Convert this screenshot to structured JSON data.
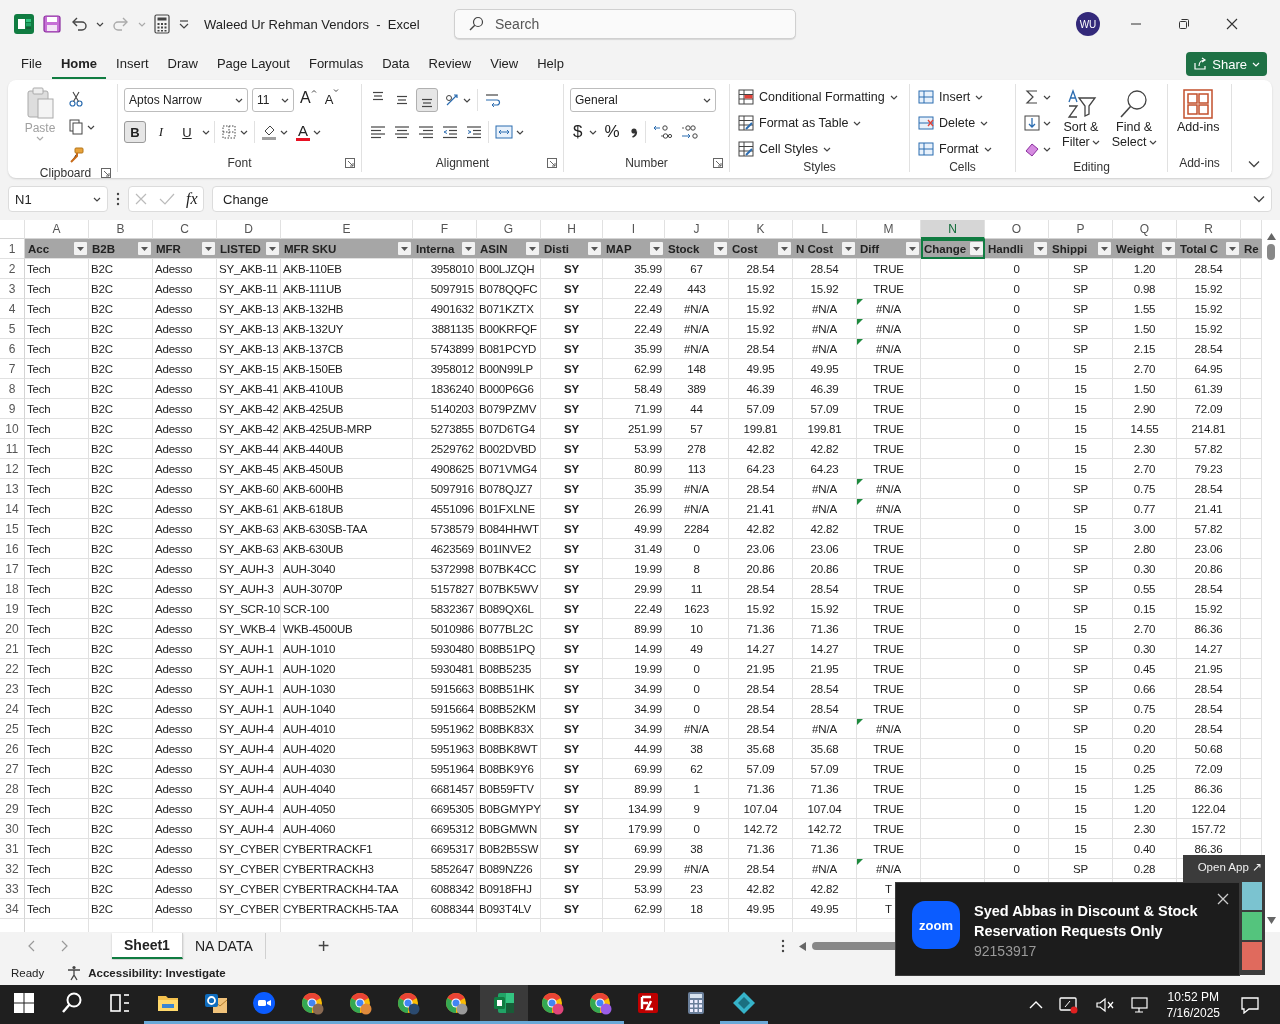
{
  "window": {
    "title": "Waleed Ur Rehman Vendors  -  Excel",
    "search": {
      "placeholder": "Search"
    },
    "avatar": "WU"
  },
  "menu": [
    {
      "label": "File",
      "selected": false
    },
    {
      "label": "Home",
      "selected": true
    },
    {
      "label": "Insert",
      "selected": false
    },
    {
      "label": "Draw",
      "selected": false
    },
    {
      "label": "Page Layout",
      "selected": false
    },
    {
      "label": "Formulas",
      "selected": false
    },
    {
      "label": "Data",
      "selected": false
    },
    {
      "label": "Review",
      "selected": false
    },
    {
      "label": "View",
      "selected": false
    },
    {
      "label": "Help",
      "selected": false
    }
  ],
  "share": "Share",
  "ribbon": {
    "groups": [
      {
        "kind": "clipboard",
        "label": "Clipboard",
        "paste": {
          "label": "Paste",
          "disabled": true
        }
      },
      {
        "kind": "font",
        "label": "Font",
        "font_name": "Aptos Narrow",
        "font_size": "11",
        "grow": "A",
        "shrink": "A",
        "font_color": "A",
        "styles": [
          {
            "label": "B",
            "selected": true
          },
          {
            "label": "I",
            "selected": false
          },
          {
            "label": "U",
            "selected": false
          }
        ]
      },
      {
        "kind": "alignment",
        "label": "Alignment",
        "vertical": [
          {
            "selected": false
          },
          {
            "selected": false
          },
          {
            "selected": true
          }
        ]
      },
      {
        "kind": "number",
        "label": "Number",
        "format": "General",
        "currency": "$",
        "percent": "%"
      },
      {
        "kind": "styles",
        "label": "Styles",
        "items": [
          "Conditional Formatting",
          "Format as Table",
          "Cell Styles"
        ]
      },
      {
        "kind": "cells",
        "label": "Cells",
        "items": [
          "Insert",
          "Delete",
          "Format"
        ]
      },
      {
        "kind": "editing",
        "label": "Editing",
        "items": [
          [
            "Sort &",
            "Filter"
          ],
          [
            "Find &",
            "Select"
          ]
        ]
      },
      {
        "kind": "addins",
        "label": "Add-ins",
        "items": [
          "Add-ins"
        ]
      }
    ]
  },
  "formula_bar": {
    "name_box": "N1",
    "function_button": "fx",
    "value": "Change"
  },
  "columns": [
    {
      "letter": "A",
      "header": "Acc",
      "selected": false
    },
    {
      "letter": "B",
      "header": "B2B",
      "selected": false
    },
    {
      "letter": "C",
      "header": "MFR",
      "selected": false
    },
    {
      "letter": "D",
      "header": "LISTED",
      "selected": false
    },
    {
      "letter": "E",
      "header": "MFR SKU",
      "selected": false
    },
    {
      "letter": "F",
      "header": "Interna",
      "selected": false
    },
    {
      "letter": "G",
      "header": "ASIN",
      "selected": false
    },
    {
      "letter": "H",
      "header": "Disti",
      "selected": false
    },
    {
      "letter": "I",
      "header": "MAP",
      "selected": false
    },
    {
      "letter": "J",
      "header": "Stock",
      "selected": false
    },
    {
      "letter": "K",
      "header": "Cost",
      "selected": false
    },
    {
      "letter": "L",
      "header": "N Cost",
      "selected": false
    },
    {
      "letter": "M",
      "header": "Diff",
      "selected": false
    },
    {
      "letter": "N",
      "header": "Change",
      "selected": true
    },
    {
      "letter": "O",
      "header": "Handli",
      "selected": false
    },
    {
      "letter": "P",
      "header": "Shippi",
      "selected": false
    },
    {
      "letter": "Q",
      "header": "Weight",
      "selected": false
    },
    {
      "letter": "R",
      "header": "Total C",
      "selected": false
    }
  ],
  "partial_column": {
    "header": "Re"
  },
  "header_row": "1",
  "rows": [
    {
      "row": "2",
      "error_flag": false,
      "cells": [
        "Tech",
        "B2C",
        "Adesso",
        "SY_AKB-11",
        "AKB-110EB",
        "3958010",
        "B00LJZQH",
        "SY",
        "35.99",
        "67",
        "28.54",
        "28.54",
        "TRUE",
        null,
        "0",
        "SP",
        "1.20",
        "28.54"
      ]
    },
    {
      "row": "3",
      "error_flag": false,
      "cells": [
        "Tech",
        "B2C",
        "Adesso",
        "SY_AKB-11",
        "AKB-111UB",
        "5097915",
        "B078QQFC",
        "SY",
        "22.49",
        "443",
        "15.92",
        "15.92",
        "TRUE",
        null,
        "0",
        "SP",
        "0.98",
        "15.92"
      ]
    },
    {
      "row": "4",
      "error_flag": true,
      "cells": [
        "Tech",
        "B2C",
        "Adesso",
        "SY_AKB-13",
        "AKB-132HB",
        "4901632",
        "B071KZTX",
        "SY",
        "22.49",
        "#N/A",
        "15.92",
        "#N/A",
        "#N/A",
        null,
        "0",
        "SP",
        "1.55",
        "15.92"
      ]
    },
    {
      "row": "5",
      "error_flag": true,
      "cells": [
        "Tech",
        "B2C",
        "Adesso",
        "SY_AKB-13",
        "AKB-132UY",
        "3881135",
        "B00KRFQF",
        "SY",
        "22.49",
        "#N/A",
        "15.92",
        "#N/A",
        "#N/A",
        null,
        "0",
        "SP",
        "1.50",
        "15.92"
      ]
    },
    {
      "row": "6",
      "error_flag": true,
      "cells": [
        "Tech",
        "B2C",
        "Adesso",
        "SY_AKB-13",
        "AKB-137CB",
        "5743899",
        "B081PCYD",
        "SY",
        "35.99",
        "#N/A",
        "28.54",
        "#N/A",
        "#N/A",
        null,
        "0",
        "SP",
        "2.15",
        "28.54"
      ]
    },
    {
      "row": "7",
      "error_flag": false,
      "cells": [
        "Tech",
        "B2C",
        "Adesso",
        "SY_AKB-15",
        "AKB-150EB",
        "3958012",
        "B00N99LP",
        "SY",
        "62.99",
        "148",
        "49.95",
        "49.95",
        "TRUE",
        null,
        "0",
        "15",
        "2.70",
        "64.95"
      ]
    },
    {
      "row": "8",
      "error_flag": false,
      "cells": [
        "Tech",
        "B2C",
        "Adesso",
        "SY_AKB-41",
        "AKB-410UB",
        "1836240",
        "B000P6G6",
        "SY",
        "58.49",
        "389",
        "46.39",
        "46.39",
        "TRUE",
        null,
        "0",
        "15",
        "1.50",
        "61.39"
      ]
    },
    {
      "row": "9",
      "error_flag": false,
      "cells": [
        "Tech",
        "B2C",
        "Adesso",
        "SY_AKB-42",
        "AKB-425UB",
        "5140203",
        "B079PZMV",
        "SY",
        "71.99",
        "44",
        "57.09",
        "57.09",
        "TRUE",
        null,
        "0",
        "15",
        "2.90",
        "72.09"
      ]
    },
    {
      "row": "10",
      "error_flag": false,
      "cells": [
        "Tech",
        "B2C",
        "Adesso",
        "SY_AKB-42",
        "AKB-425UB-MRP",
        "5273855",
        "B07D6TG4",
        "SY",
        "251.99",
        "57",
        "199.81",
        "199.81",
        "TRUE",
        null,
        "0",
        "15",
        "14.55",
        "214.81"
      ]
    },
    {
      "row": "11",
      "error_flag": false,
      "cells": [
        "Tech",
        "B2C",
        "Adesso",
        "SY_AKB-44",
        "AKB-440UB",
        "2529762",
        "B002DVBD",
        "SY",
        "53.99",
        "278",
        "42.82",
        "42.82",
        "TRUE",
        null,
        "0",
        "15",
        "2.30",
        "57.82"
      ]
    },
    {
      "row": "12",
      "error_flag": false,
      "cells": [
        "Tech",
        "B2C",
        "Adesso",
        "SY_AKB-45",
        "AKB-450UB",
        "4908625",
        "B071VMG4",
        "SY",
        "80.99",
        "113",
        "64.23",
        "64.23",
        "TRUE",
        null,
        "0",
        "15",
        "2.70",
        "79.23"
      ]
    },
    {
      "row": "13",
      "error_flag": true,
      "cells": [
        "Tech",
        "B2C",
        "Adesso",
        "SY_AKB-60",
        "AKB-600HB",
        "5097916",
        "B078QJZ7",
        "SY",
        "35.99",
        "#N/A",
        "28.54",
        "#N/A",
        "#N/A",
        null,
        "0",
        "SP",
        "0.75",
        "28.54"
      ]
    },
    {
      "row": "14",
      "error_flag": true,
      "cells": [
        "Tech",
        "B2C",
        "Adesso",
        "SY_AKB-61",
        "AKB-618UB",
        "4551096",
        "B01FXLNE",
        "SY",
        "26.99",
        "#N/A",
        "21.41",
        "#N/A",
        "#N/A",
        null,
        "0",
        "SP",
        "0.77",
        "21.41"
      ]
    },
    {
      "row": "15",
      "error_flag": false,
      "cells": [
        "Tech",
        "B2C",
        "Adesso",
        "SY_AKB-63",
        "AKB-630SB-TAA",
        "5738579",
        "B084HHWT",
        "SY",
        "49.99",
        "2284",
        "42.82",
        "42.82",
        "TRUE",
        null,
        "0",
        "15",
        "3.00",
        "57.82"
      ]
    },
    {
      "row": "16",
      "error_flag": false,
      "cells": [
        "Tech",
        "B2C",
        "Adesso",
        "SY_AKB-63",
        "AKB-630UB",
        "4623569",
        "B01INVE2",
        "SY",
        "31.49",
        "0",
        "23.06",
        "23.06",
        "TRUE",
        null,
        "0",
        "SP",
        "2.80",
        "23.06"
      ]
    },
    {
      "row": "17",
      "error_flag": false,
      "cells": [
        "Tech",
        "B2C",
        "Adesso",
        "SY_AUH-3",
        "AUH-3040",
        "5372998",
        "B07BK4CC",
        "SY",
        "19.99",
        "8",
        "20.86",
        "20.86",
        "TRUE",
        null,
        "0",
        "SP",
        "0.30",
        "20.86"
      ]
    },
    {
      "row": "18",
      "error_flag": false,
      "cells": [
        "Tech",
        "B2C",
        "Adesso",
        "SY_AUH-3",
        "AUH-3070P",
        "5157827",
        "B07BK5WV",
        "SY",
        "29.99",
        "11",
        "28.54",
        "28.54",
        "TRUE",
        null,
        "0",
        "SP",
        "0.55",
        "28.54"
      ]
    },
    {
      "row": "19",
      "error_flag": false,
      "cells": [
        "Tech",
        "B2C",
        "Adesso",
        "SY_SCR-10",
        "SCR-100",
        "5832367",
        "B089QX6L",
        "SY",
        "22.49",
        "1623",
        "15.92",
        "15.92",
        "TRUE",
        null,
        "0",
        "SP",
        "0.15",
        "15.92"
      ]
    },
    {
      "row": "20",
      "error_flag": false,
      "cells": [
        "Tech",
        "B2C",
        "Adesso",
        "SY_WKB-4",
        "WKB-4500UB",
        "5010986",
        "B077BL2C",
        "SY",
        "89.99",
        "10",
        "71.36",
        "71.36",
        "TRUE",
        null,
        "0",
        "15",
        "2.70",
        "86.36"
      ]
    },
    {
      "row": "21",
      "error_flag": false,
      "cells": [
        "Tech",
        "B2C",
        "Adesso",
        "SY_AUH-1",
        "AUH-1010",
        "5930480",
        "B08B51PQ",
        "SY",
        "14.99",
        "49",
        "14.27",
        "14.27",
        "TRUE",
        null,
        "0",
        "SP",
        "0.30",
        "14.27"
      ]
    },
    {
      "row": "22",
      "error_flag": false,
      "cells": [
        "Tech",
        "B2C",
        "Adesso",
        "SY_AUH-1",
        "AUH-1020",
        "5930481",
        "B08B5235",
        "SY",
        "19.99",
        "0",
        "21.95",
        "21.95",
        "TRUE",
        null,
        "0",
        "SP",
        "0.45",
        "21.95"
      ]
    },
    {
      "row": "23",
      "error_flag": false,
      "cells": [
        "Tech",
        "B2C",
        "Adesso",
        "SY_AUH-1",
        "AUH-1030",
        "5915663",
        "B08B51HK",
        "SY",
        "34.99",
        "0",
        "28.54",
        "28.54",
        "TRUE",
        null,
        "0",
        "SP",
        "0.66",
        "28.54"
      ]
    },
    {
      "row": "24",
      "error_flag": false,
      "cells": [
        "Tech",
        "B2C",
        "Adesso",
        "SY_AUH-1",
        "AUH-1040",
        "5915664",
        "B08B52KM",
        "SY",
        "34.99",
        "0",
        "28.54",
        "28.54",
        "TRUE",
        null,
        "0",
        "SP",
        "0.75",
        "28.54"
      ]
    },
    {
      "row": "25",
      "error_flag": true,
      "cells": [
        "Tech",
        "B2C",
        "Adesso",
        "SY_AUH-4",
        "AUH-4010",
        "5951962",
        "B08BK83X",
        "SY",
        "34.99",
        "#N/A",
        "28.54",
        "#N/A",
        "#N/A",
        null,
        "0",
        "SP",
        "0.20",
        "28.54"
      ]
    },
    {
      "row": "26",
      "error_flag": false,
      "cells": [
        "Tech",
        "B2C",
        "Adesso",
        "SY_AUH-4",
        "AUH-4020",
        "5951963",
        "B08BK8WT",
        "SY",
        "44.99",
        "38",
        "35.68",
        "35.68",
        "TRUE",
        null,
        "0",
        "15",
        "0.20",
        "50.68"
      ]
    },
    {
      "row": "27",
      "error_flag": false,
      "cells": [
        "Tech",
        "B2C",
        "Adesso",
        "SY_AUH-4",
        "AUH-4030",
        "5951964",
        "B08BK9Y6",
        "SY",
        "69.99",
        "62",
        "57.09",
        "57.09",
        "TRUE",
        null,
        "0",
        "15",
        "0.25",
        "72.09"
      ]
    },
    {
      "row": "28",
      "error_flag": false,
      "cells": [
        "Tech",
        "B2C",
        "Adesso",
        "SY_AUH-4",
        "AUH-4040",
        "6681457",
        "B0B59FTV",
        "SY",
        "89.99",
        "1",
        "71.36",
        "71.36",
        "TRUE",
        null,
        "0",
        "15",
        "1.25",
        "86.36"
      ]
    },
    {
      "row": "29",
      "error_flag": false,
      "cells": [
        "Tech",
        "B2C",
        "Adesso",
        "SY_AUH-4",
        "AUH-4050",
        "6695305",
        "B0BGMYPY",
        "SY",
        "134.99",
        "9",
        "107.04",
        "107.04",
        "TRUE",
        null,
        "0",
        "15",
        "1.20",
        "122.04"
      ]
    },
    {
      "row": "30",
      "error_flag": false,
      "cells": [
        "Tech",
        "B2C",
        "Adesso",
        "SY_AUH-4",
        "AUH-4060",
        "6695312",
        "B0BGMWN",
        "SY",
        "179.99",
        "0",
        "142.72",
        "142.72",
        "TRUE",
        null,
        "0",
        "15",
        "2.30",
        "157.72"
      ]
    },
    {
      "row": "31",
      "error_flag": false,
      "cells": [
        "Tech",
        "B2C",
        "Adesso",
        "SY_CYBER",
        "CYBERTRACKF1",
        "6695317",
        "B0B2B5SW",
        "SY",
        "69.99",
        "38",
        "71.36",
        "71.36",
        "TRUE",
        null,
        "0",
        "15",
        "0.40",
        "86.36"
      ]
    },
    {
      "row": "32",
      "error_flag": true,
      "cells": [
        "Tech",
        "B2C",
        "Adesso",
        "SY_CYBER",
        "CYBERTRACKH3",
        "5852647",
        "B089NZ26",
        "SY",
        "29.99",
        "#N/A",
        "28.54",
        "#N/A",
        "#N/A",
        null,
        "0",
        "SP",
        "0.28",
        null
      ]
    },
    {
      "row": "33",
      "error_flag": false,
      "cells": [
        "Tech",
        "B2C",
        "Adesso",
        "SY_CYBER",
        "CYBERTRACKH4-TAA",
        "6088342",
        "B0918FHJ",
        "SY",
        "53.99",
        "23",
        "42.82",
        "42.82",
        "T",
        null,
        null,
        null,
        null,
        null
      ]
    },
    {
      "row": "34",
      "error_flag": false,
      "cells": [
        "Tech",
        "B2C",
        "Adesso",
        "SY_CYBER",
        "CYBERTRACKH5-TAA",
        "6088344",
        "B093T4LV",
        "SY",
        "62.99",
        "18",
        "49.95",
        "49.95",
        "T",
        null,
        null,
        null,
        null,
        null
      ]
    }
  ],
  "sheets": [
    {
      "label": "Sheet1",
      "selected": true
    },
    {
      "label": "NA DATA",
      "selected": false
    }
  ],
  "add_sheet": "+",
  "status_bar": {
    "ready": "Ready",
    "accessibility": "Accessibility: Investigate"
  },
  "open_app": "Open App ↗",
  "notification": {
    "logo": "zoom",
    "title": "Syed Abbas in Discount & Stock Reservation Requests Only",
    "subtitle": "92153917"
  },
  "taskbar": {
    "apps": [
      {
        "kind": "windows",
        "running": false
      },
      {
        "kind": "search",
        "running": false
      },
      {
        "kind": "taskview",
        "running": false
      },
      {
        "kind": "explorer",
        "running": true
      },
      {
        "kind": "outlook",
        "running": true
      },
      {
        "kind": "zoom",
        "running": true
      },
      {
        "kind": "chrome",
        "color": "#8a6a52",
        "running": true
      },
      {
        "kind": "chrome",
        "color": "#e08a3c",
        "running": true
      },
      {
        "kind": "chrome",
        "color": "#2b4a6f",
        "running": true
      },
      {
        "kind": "chrome",
        "color": "#9a9a9a",
        "running": true
      },
      {
        "kind": "excel",
        "running": true
      },
      {
        "kind": "chrome",
        "color": "#e0457a",
        "running": true
      },
      {
        "kind": "chrome",
        "color": "#9b5de5",
        "running": true
      },
      {
        "kind": "filezilla",
        "running": false
      },
      {
        "kind": "calculator",
        "running": false
      },
      {
        "kind": "app",
        "running": true
      }
    ],
    "time": "10:52 PM",
    "date": "7/16/2025"
  }
}
